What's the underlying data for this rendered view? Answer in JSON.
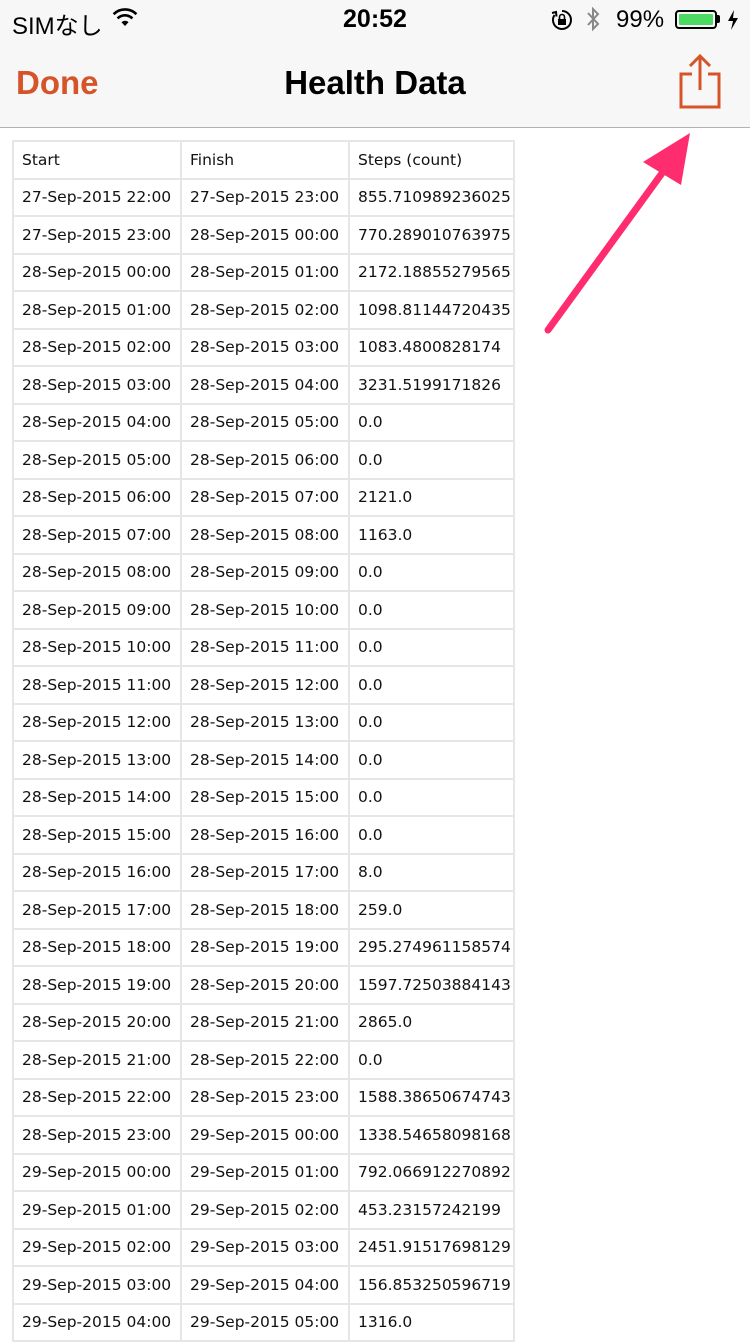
{
  "status_bar": {
    "carrier": "SIMなし",
    "time": "20:52",
    "battery_percent": "99%",
    "battery_level": 0.99,
    "battery_color": "#4cd964"
  },
  "nav": {
    "done_label": "Done",
    "title": "Health Data",
    "share_icon": "share-icon",
    "accent_color": "#d5542a"
  },
  "table": {
    "headers": [
      "Start",
      "Finish",
      "Steps (count)"
    ],
    "rows": [
      [
        "27-Sep-2015 22:00",
        "27-Sep-2015 23:00",
        "855.710989236025"
      ],
      [
        "27-Sep-2015 23:00",
        "28-Sep-2015 00:00",
        "770.289010763975"
      ],
      [
        "28-Sep-2015 00:00",
        "28-Sep-2015 01:00",
        "2172.18855279565"
      ],
      [
        "28-Sep-2015 01:00",
        "28-Sep-2015 02:00",
        "1098.81144720435"
      ],
      [
        "28-Sep-2015 02:00",
        "28-Sep-2015 03:00",
        "1083.4800828174"
      ],
      [
        "28-Sep-2015 03:00",
        "28-Sep-2015 04:00",
        "3231.5199171826"
      ],
      [
        "28-Sep-2015 04:00",
        "28-Sep-2015 05:00",
        "0.0"
      ],
      [
        "28-Sep-2015 05:00",
        "28-Sep-2015 06:00",
        "0.0"
      ],
      [
        "28-Sep-2015 06:00",
        "28-Sep-2015 07:00",
        "2121.0"
      ],
      [
        "28-Sep-2015 07:00",
        "28-Sep-2015 08:00",
        "1163.0"
      ],
      [
        "28-Sep-2015 08:00",
        "28-Sep-2015 09:00",
        "0.0"
      ],
      [
        "28-Sep-2015 09:00",
        "28-Sep-2015 10:00",
        "0.0"
      ],
      [
        "28-Sep-2015 10:00",
        "28-Sep-2015 11:00",
        "0.0"
      ],
      [
        "28-Sep-2015 11:00",
        "28-Sep-2015 12:00",
        "0.0"
      ],
      [
        "28-Sep-2015 12:00",
        "28-Sep-2015 13:00",
        "0.0"
      ],
      [
        "28-Sep-2015 13:00",
        "28-Sep-2015 14:00",
        "0.0"
      ],
      [
        "28-Sep-2015 14:00",
        "28-Sep-2015 15:00",
        "0.0"
      ],
      [
        "28-Sep-2015 15:00",
        "28-Sep-2015 16:00",
        "0.0"
      ],
      [
        "28-Sep-2015 16:00",
        "28-Sep-2015 17:00",
        "8.0"
      ],
      [
        "28-Sep-2015 17:00",
        "28-Sep-2015 18:00",
        "259.0"
      ],
      [
        "28-Sep-2015 18:00",
        "28-Sep-2015 19:00",
        "295.274961158574"
      ],
      [
        "28-Sep-2015 19:00",
        "28-Sep-2015 20:00",
        "1597.72503884143"
      ],
      [
        "28-Sep-2015 20:00",
        "28-Sep-2015 21:00",
        "2865.0"
      ],
      [
        "28-Sep-2015 21:00",
        "28-Sep-2015 22:00",
        "0.0"
      ],
      [
        "28-Sep-2015 22:00",
        "28-Sep-2015 23:00",
        "1588.38650674743"
      ],
      [
        "28-Sep-2015 23:00",
        "29-Sep-2015 00:00",
        "1338.54658098168"
      ],
      [
        "29-Sep-2015 00:00",
        "29-Sep-2015 01:00",
        "792.066912270892"
      ],
      [
        "29-Sep-2015 01:00",
        "29-Sep-2015 02:00",
        "453.23157242199"
      ],
      [
        "29-Sep-2015 02:00",
        "29-Sep-2015 03:00",
        "2451.91517698129"
      ],
      [
        "29-Sep-2015 03:00",
        "29-Sep-2015 04:00",
        "156.853250596719"
      ],
      [
        "29-Sep-2015 04:00",
        "29-Sep-2015 05:00",
        "1316.0"
      ]
    ]
  },
  "annotation": {
    "arrow_color": "#ff2d6f",
    "arrow_icon": "pointer-arrow-icon"
  }
}
